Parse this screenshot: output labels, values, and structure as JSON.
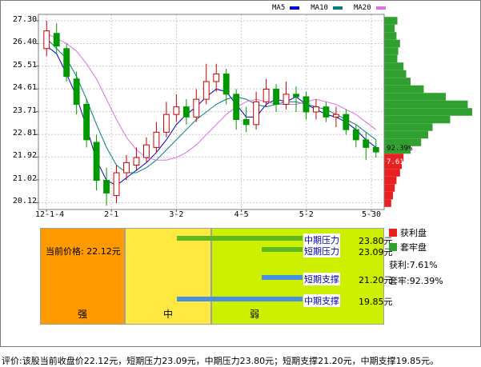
{
  "colors": {
    "ma5": "#0000cc",
    "ma10": "#008080",
    "ma20": "#e070e0",
    "up": "#cc0000",
    "down": "#009900",
    "profit": "#e82020",
    "trapped": "#30a030",
    "strong_zone": "#ff9a00",
    "mid_zone": "#ffe840",
    "weak_zone": "#ccf000",
    "resistance_bar": "#60b820",
    "support_bar": "#4a90e0"
  },
  "legend": {
    "ma5": "MA5",
    "ma10": "MA10",
    "ma20": "MA20"
  },
  "chip_labels": {
    "trapped_pct": "92.39%",
    "profit_pct": "7.61%"
  },
  "analysis": {
    "current_price": "当前价格: 22.12元",
    "zones": {
      "strong": "强",
      "mid": "中",
      "weak": "弱"
    },
    "levels": [
      {
        "name": "中期压力",
        "price": "23.80元",
        "value": 23.8,
        "kind": "resistance"
      },
      {
        "name": "短期压力",
        "price": "23.09元",
        "value": 23.09,
        "kind": "resistance"
      },
      {
        "name": "短期支撑",
        "price": "21.20元",
        "value": 21.2,
        "kind": "support"
      },
      {
        "name": "中期支撑",
        "price": "19.85元",
        "value": 19.85,
        "kind": "support"
      }
    ],
    "dist_legend": {
      "profit": "获利盘",
      "trapped": "套牢盘",
      "profit_stat": "获利:7.61%",
      "trapped_stat": "套牢:92.39%"
    }
  },
  "footer": "评价:该股当前收盘价22.12元，短期压力23.09元，中期压力23.80元；短期支撑21.20元，中期支撑19.85元。",
  "chart_data": {
    "type": "candlestick",
    "title": "",
    "ylim": [
      19.85,
      27.55
    ],
    "yticks": [
      "27.30",
      "26.40",
      "25.51",
      "24.61",
      "23.71",
      "22.81",
      "21.92",
      "21.02",
      "20.12"
    ],
    "xticks": [
      "12-1-4",
      "2-1",
      "3-2",
      "4-5",
      "5-2",
      "5-30"
    ],
    "series": [
      {
        "name": "MA5",
        "values": [
          26.3,
          26.0,
          25.2,
          24.3,
          23.1,
          21.8,
          21.0,
          20.8,
          21.1,
          21.4,
          21.7,
          22.1,
          22.6,
          23.2,
          23.6,
          23.9,
          24.3,
          24.6,
          24.5,
          24.0,
          23.5,
          23.5,
          24.0,
          24.2,
          24.1,
          24.3,
          24.0,
          23.8,
          23.6,
          23.5,
          23.3,
          23.0,
          22.6,
          22.3
        ]
      },
      {
        "name": "MA10",
        "values": [
          26.6,
          26.2,
          25.8,
          25.1,
          24.2,
          23.2,
          22.3,
          21.6,
          21.3,
          21.3,
          21.5,
          21.8,
          22.2,
          22.6,
          23.0,
          23.4,
          23.7,
          24.0,
          24.2,
          24.3,
          24.2,
          24.0,
          23.9,
          24.0,
          24.1,
          24.1,
          24.0,
          23.9,
          23.8,
          23.6,
          23.4,
          23.2,
          22.9,
          22.6
        ]
      },
      {
        "name": "MA20",
        "values": [
          26.8,
          26.6,
          26.4,
          26.1,
          25.6,
          25.0,
          24.2,
          23.4,
          22.7,
          22.2,
          21.9,
          21.8,
          21.8,
          21.9,
          22.1,
          22.4,
          22.8,
          23.2,
          23.6,
          23.9,
          24.1,
          24.2,
          24.1,
          24.0,
          24.0,
          24.0,
          24.1,
          24.2,
          24.1,
          24.0,
          23.8,
          23.6,
          23.3,
          23.0
        ]
      }
    ],
    "candles": [
      {
        "o": 26.2,
        "c": 26.9,
        "h": 27.3,
        "l": 25.9
      },
      {
        "o": 26.8,
        "c": 26.3,
        "h": 27.2,
        "l": 26.0
      },
      {
        "o": 26.2,
        "c": 25.1,
        "h": 26.4,
        "l": 24.9
      },
      {
        "o": 25.0,
        "c": 24.0,
        "h": 25.3,
        "l": 23.6
      },
      {
        "o": 24.0,
        "c": 22.6,
        "h": 24.2,
        "l": 22.3
      },
      {
        "o": 22.5,
        "c": 21.0,
        "h": 22.8,
        "l": 20.6
      },
      {
        "o": 21.0,
        "c": 20.5,
        "h": 21.5,
        "l": 20.0
      },
      {
        "o": 20.4,
        "c": 21.3,
        "h": 21.6,
        "l": 20.1
      },
      {
        "o": 21.3,
        "c": 21.7,
        "h": 22.0,
        "l": 21.0
      },
      {
        "o": 21.6,
        "c": 21.9,
        "h": 22.3,
        "l": 21.4
      },
      {
        "o": 21.9,
        "c": 22.4,
        "h": 22.7,
        "l": 21.7
      },
      {
        "o": 22.3,
        "c": 22.9,
        "h": 23.3,
        "l": 22.1
      },
      {
        "o": 22.9,
        "c": 23.6,
        "h": 24.1,
        "l": 22.7
      },
      {
        "o": 23.6,
        "c": 23.9,
        "h": 24.4,
        "l": 23.3
      },
      {
        "o": 23.9,
        "c": 23.5,
        "h": 24.2,
        "l": 23.2
      },
      {
        "o": 23.5,
        "c": 24.2,
        "h": 24.6,
        "l": 23.3
      },
      {
        "o": 24.2,
        "c": 24.9,
        "h": 25.6,
        "l": 24.0
      },
      {
        "o": 24.9,
        "c": 25.2,
        "h": 25.6,
        "l": 24.5
      },
      {
        "o": 25.2,
        "c": 24.4,
        "h": 25.4,
        "l": 24.0
      },
      {
        "o": 24.4,
        "c": 23.4,
        "h": 24.6,
        "l": 23.0
      },
      {
        "o": 23.4,
        "c": 23.2,
        "h": 23.9,
        "l": 22.9
      },
      {
        "o": 23.2,
        "c": 24.1,
        "h": 24.5,
        "l": 23.0
      },
      {
        "o": 24.1,
        "c": 24.6,
        "h": 25.0,
        "l": 23.9
      },
      {
        "o": 24.6,
        "c": 24.0,
        "h": 24.8,
        "l": 23.7
      },
      {
        "o": 24.0,
        "c": 24.4,
        "h": 24.9,
        "l": 23.8
      },
      {
        "o": 24.4,
        "c": 24.3,
        "h": 24.7,
        "l": 23.7
      },
      {
        "o": 24.3,
        "c": 23.7,
        "h": 24.5,
        "l": 23.4
      },
      {
        "o": 23.7,
        "c": 23.9,
        "h": 24.2,
        "l": 23.4
      },
      {
        "o": 23.9,
        "c": 23.5,
        "h": 24.1,
        "l": 23.3
      },
      {
        "o": 23.5,
        "c": 23.6,
        "h": 23.9,
        "l": 23.1
      },
      {
        "o": 23.6,
        "c": 23.0,
        "h": 23.8,
        "l": 22.8
      },
      {
        "o": 23.0,
        "c": 22.6,
        "h": 23.2,
        "l": 22.3
      },
      {
        "o": 22.6,
        "c": 22.3,
        "h": 22.9,
        "l": 21.8
      },
      {
        "o": 22.3,
        "c": 22.12,
        "h": 22.6,
        "l": 21.9
      }
    ],
    "chip_distribution": {
      "profit_pct": 7.61,
      "trapped_pct": 92.39,
      "levels": [
        27.3,
        27.0,
        26.7,
        26.4,
        26.1,
        25.8,
        25.5,
        25.2,
        24.9,
        24.6,
        24.3,
        24.0,
        23.7,
        23.4,
        23.1,
        22.8,
        22.5,
        22.2,
        21.9,
        21.6,
        21.3,
        21.0,
        20.7,
        20.4,
        20.1
      ],
      "weights": [
        0.15,
        0.12,
        0.14,
        0.18,
        0.16,
        0.15,
        0.22,
        0.25,
        0.3,
        0.45,
        0.7,
        0.95,
        1.0,
        0.75,
        0.55,
        0.5,
        0.42,
        0.3,
        0.22,
        0.2,
        0.18,
        0.14,
        0.12,
        0.1,
        0.08
      ]
    }
  }
}
